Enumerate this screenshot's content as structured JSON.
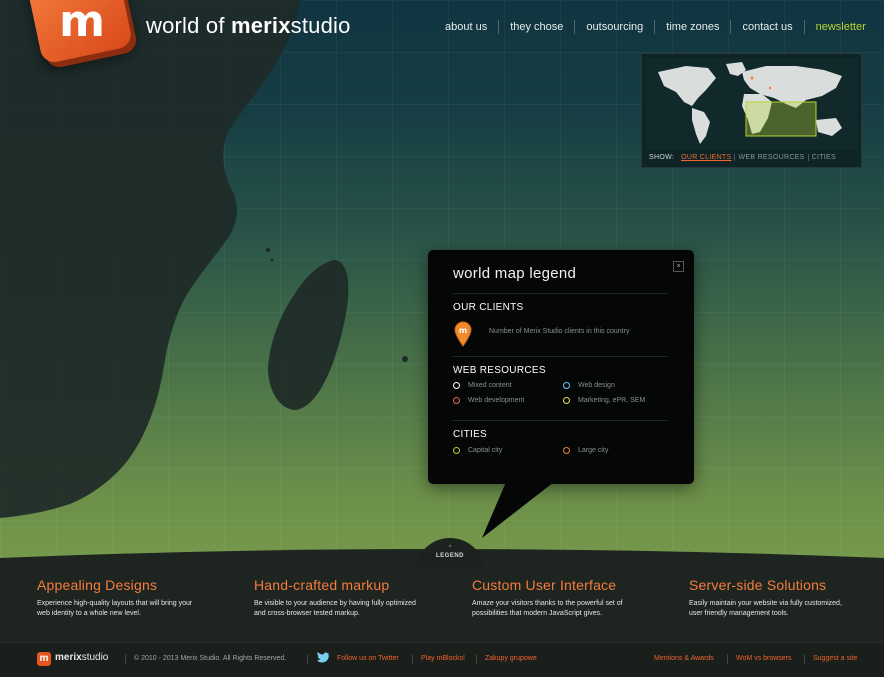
{
  "header": {
    "title_pre": "world of ",
    "title_bold": "merix",
    "title_post": "studio",
    "logo_letter": "m"
  },
  "nav": {
    "items": [
      {
        "label": "about us"
      },
      {
        "label": "they chose"
      },
      {
        "label": "outsourcing"
      },
      {
        "label": "time zones"
      },
      {
        "label": "contact us"
      },
      {
        "label": "newsletter"
      }
    ]
  },
  "minimap": {
    "show_label": "SHOW:",
    "options": [
      {
        "label": "OUR CLIENTS"
      },
      {
        "label": "WEB RESOURCES"
      },
      {
        "label": "CITIES"
      }
    ]
  },
  "legend": {
    "title": "world map legend",
    "close": "×",
    "clients": {
      "heading": "OUR CLIENTS",
      "pin_letter": "m",
      "description": "Number of Merix Studio clients in this country"
    },
    "web_resources": {
      "heading": "WEB RESOURCES",
      "items": [
        {
          "label": "Mixed content",
          "color": "#ffffff"
        },
        {
          "label": "Web design",
          "color": "#5fd0f0"
        },
        {
          "label": "Web development",
          "color": "#f06060"
        },
        {
          "label": "Marketing, ePR, SEM",
          "color": "#f0e050"
        }
      ]
    },
    "cities": {
      "heading": "CITIES",
      "items": [
        {
          "label": "Capital city",
          "color": "#b7d432"
        },
        {
          "label": "Large city",
          "color": "#f47d3c"
        }
      ]
    },
    "tab_arrow": "^",
    "tab_label": "LEGEND"
  },
  "features": [
    {
      "title": "Appealing Designs",
      "text_1": "Experience high-quality layouts that will bring your",
      "text_2": "web identity to a whole new level."
    },
    {
      "title": "Hand-crafted markup",
      "text_1": "Be visible to your audience by having fully optimized",
      "text_2": "and cross-browser tested markup."
    },
    {
      "title": "Custom User Interface",
      "text_1": "Amaze your visitors thanks to the powerful set of",
      "text_2": "possibilities that modern JavaScript gives."
    },
    {
      "title": "Server-side Solutions",
      "text_1": "Easily maintain your website via fully customized,",
      "text_2": "user friendly management tools."
    }
  ],
  "footer": {
    "logo_letter": "m",
    "brand_bold": "merix",
    "brand_rest": "studio",
    "copyright": "© 2010 - 2013 Merix Studio. All Rights Reserved.",
    "twitter": "Follow us on Twitter",
    "play": "Play mBlocks!",
    "zakupy": "Zakupy grupowe",
    "mentions": "Mentions & Awards",
    "wom": "WoM vs browsers",
    "suggest": "Suggest a site"
  },
  "colors": {
    "accent": "#f47d3c",
    "highlight": "#b7d432",
    "link": "#f0622c"
  }
}
